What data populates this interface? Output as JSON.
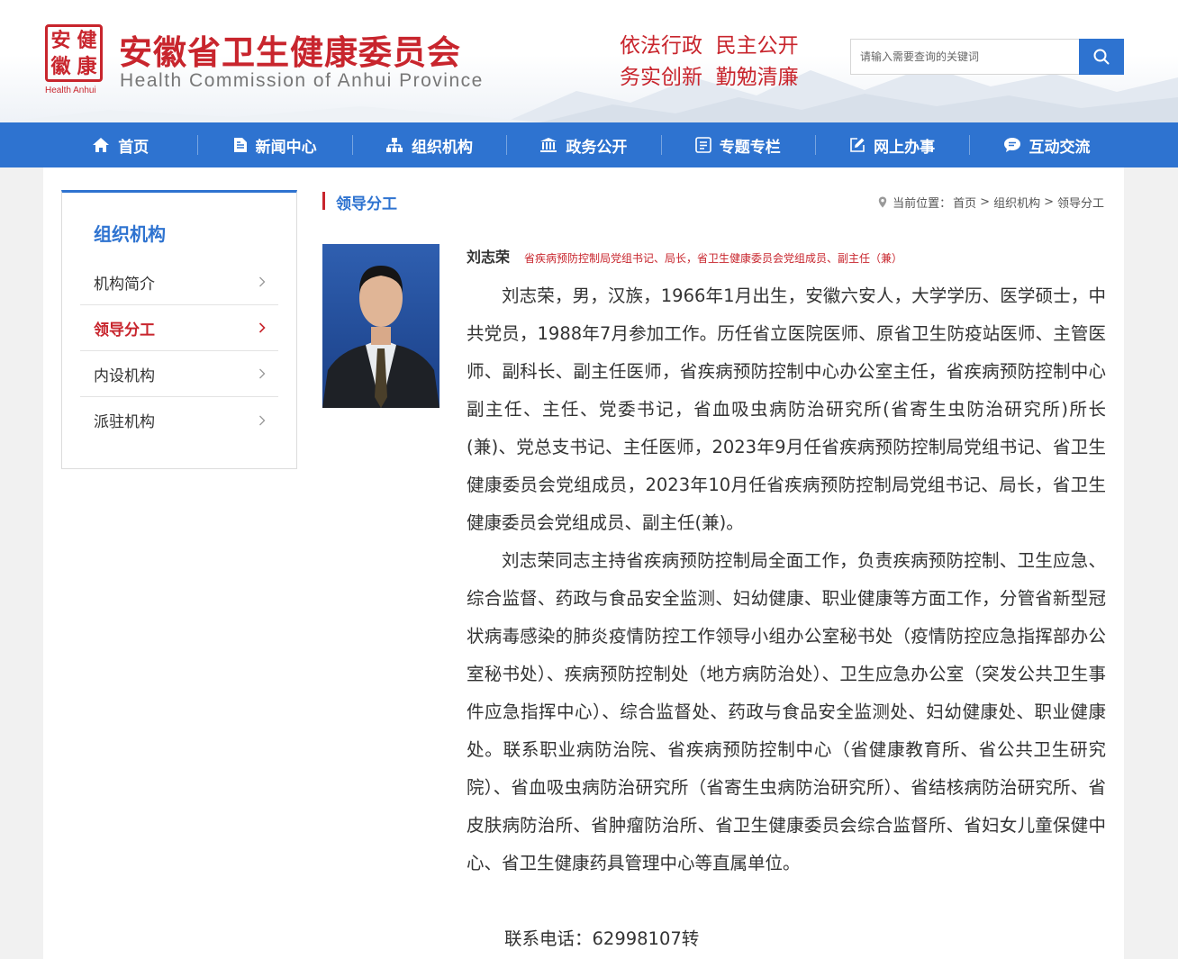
{
  "header": {
    "logo_chars": [
      "安",
      "健",
      "徽",
      "康"
    ],
    "logo_sub": "Health Anhui",
    "title_cn": "安徽省卫生健康委员会",
    "title_en": "Health Commission of Anhui Province",
    "slogan_line1": "依法行政  民主公开",
    "slogan_line2": "务实创新  勤勉清廉",
    "search_placeholder": "请输入需要查询的关键词",
    "accent_color": "#c8252d",
    "brand_blue": "#2e73d0"
  },
  "nav": {
    "items": [
      {
        "label": "首页",
        "icon": "home-icon"
      },
      {
        "label": "新闻中心",
        "icon": "document-icon"
      },
      {
        "label": "组织机构",
        "icon": "org-chart-icon"
      },
      {
        "label": "政务公开",
        "icon": "building-icon"
      },
      {
        "label": "专题专栏",
        "icon": "list-icon"
      },
      {
        "label": "网上办事",
        "icon": "edit-icon"
      },
      {
        "label": "互动交流",
        "icon": "chat-icon"
      }
    ]
  },
  "sidebar": {
    "title": "组织机构",
    "items": [
      {
        "label": "机构简介",
        "active": false
      },
      {
        "label": "领导分工",
        "active": true
      },
      {
        "label": "内设机构",
        "active": false
      },
      {
        "label": "派驻机构",
        "active": false
      }
    ]
  },
  "breadcrumb": {
    "section_title": "领导分工",
    "prefix": "当前位置：",
    "path": [
      "首页",
      "组织机构",
      "领导分工"
    ],
    "separator": ">"
  },
  "leader": {
    "name": "刘志荣",
    "title": "省疾病预防控制局党组书记、局长，省卫生健康委员会党组成员、副主任（兼）",
    "bio_p1": "刘志荣，男，汉族，1966年1月出生，安徽六安人，大学学历、医学硕士，中共党员，1988年7月参加工作。历任省立医院医师、原省卫生防疫站医师、主管医师、副科长、副主任医师，省疾病预防控制中心办公室主任，省疾病预防控制中心副主任、主任、党委书记，省血吸虫病防治研究所(省寄生虫防治研究所)所长(兼)、党总支书记、主任医师，2023年9月任省疾病预防控制局党组书记、省卫生健康委员会党组成员，2023年10月任省疾病预防控制局党组书记、局长，省卫生健康委员会党组成员、副主任(兼)。",
    "bio_p2": "刘志荣同志主持省疾病预防控制局全面工作，负责疾病预防控制、卫生应急、综合监督、药政与食品安全监测、妇幼健康、职业健康等方面工作，分管省新型冠状病毒感染的肺炎疫情防控工作领导小组办公室秘书处（疫情防控应急指挥部办公室秘书处）、疾病预防控制处（地方病防治处）、卫生应急办公室（突发公共卫生事件应急指挥中心）、综合监督处、药政与食品安全监测处、妇幼健康处、职业健康处。联系职业病防治院、省疾病预防控制中心（省健康教育所、省公共卫生研究院）、省血吸虫病防治研究所（省寄生虫病防治研究所）、省结核病防治研究所、省皮肤病防治所、省肿瘤防治所、省卫生健康委员会综合监督所、省妇女儿童保健中心、省卫生健康药具管理中心等直属单位。",
    "phone_label": "联系电话：",
    "phone_value": "62998107转"
  }
}
